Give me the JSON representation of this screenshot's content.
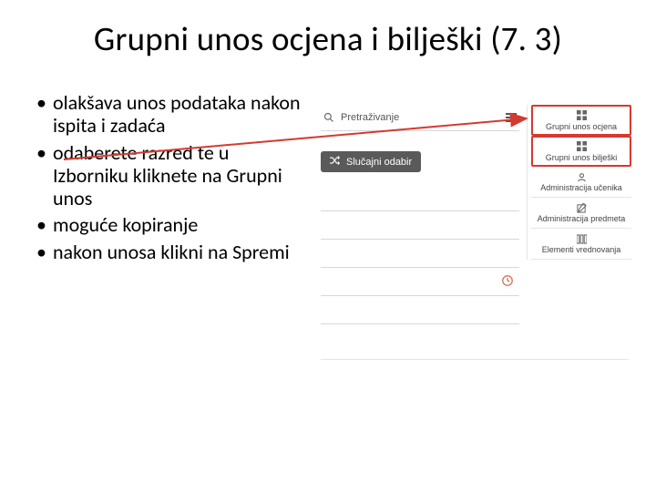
{
  "title": "Grupni unos ocjena i bilješki (7. 3)",
  "bullets": [
    "olakšava unos podataka nakon ispita i zadaća",
    "odaberete razred te u Izborniku kliknete na Grupni unos",
    "moguće kopiranje",
    "nakon unosa klikni na Spremi"
  ],
  "ui": {
    "search_label": "Pretraživanje",
    "random_button": "Slučajni odabir",
    "menu": [
      {
        "label": "Grupni unos ocjena",
        "icon": "grid",
        "highlight": true
      },
      {
        "label": "Grupni unos bilješki",
        "icon": "grid",
        "highlight": true
      },
      {
        "label": "Administracija učenika",
        "icon": "person",
        "highlight": false
      },
      {
        "label": "Administracija predmeta",
        "icon": "edit",
        "highlight": false
      },
      {
        "label": "Elementi vrednovanja",
        "icon": "columns",
        "highlight": false
      }
    ]
  }
}
